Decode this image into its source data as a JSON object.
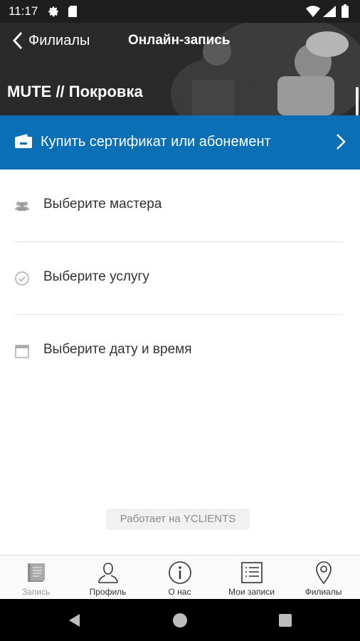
{
  "status_bar": {
    "time": "11:17"
  },
  "header": {
    "back_label": "Филиалы",
    "title": "Онлайн-запись",
    "branch_name": "MUTE // Покровка"
  },
  "certificate": {
    "label": "Купить сертификат или абонемент"
  },
  "menu": [
    {
      "label": "Выберите мастера",
      "icon": "people-icon"
    },
    {
      "label": "Выберите услугу",
      "icon": "check-circle-icon"
    },
    {
      "label": "Выберите дату и время",
      "icon": "calendar-icon"
    }
  ],
  "powered_by": "Работает на YCLIENTS",
  "tabs": [
    {
      "label": "Запись",
      "icon": "book-icon",
      "active": true
    },
    {
      "label": "Профиль",
      "icon": "person-icon"
    },
    {
      "label": "О нас",
      "icon": "info-icon"
    },
    {
      "label": "Мои записи",
      "icon": "list-icon"
    },
    {
      "label": "Филиалы",
      "icon": "location-pin-icon"
    }
  ],
  "colors": {
    "accent": "#0a6fb5",
    "header_bg": "#2b2b2b",
    "status_bar": "#1e1e1e"
  }
}
